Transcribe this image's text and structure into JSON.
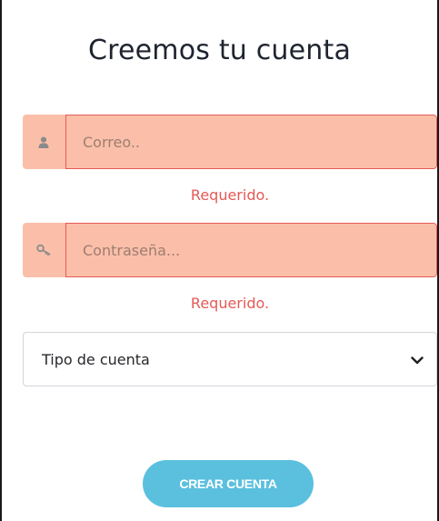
{
  "form": {
    "title": "Creemos tu cuenta",
    "email": {
      "placeholder": "Correo..",
      "value": "",
      "icon": "user-icon",
      "error": "Requerido."
    },
    "password": {
      "placeholder": "Contraseña...",
      "value": "",
      "icon": "key-icon",
      "error": "Requerido."
    },
    "account_type": {
      "selected": "Tipo de cuenta",
      "icon": "chevron-down-icon"
    },
    "submit_label": "CREAR CUENTA"
  },
  "colors": {
    "error_bg": "#fbbfa9",
    "error_border": "#e55a56",
    "error_text": "#e55a56",
    "button_bg": "#5bc0de",
    "button_text": "#ffffff"
  }
}
